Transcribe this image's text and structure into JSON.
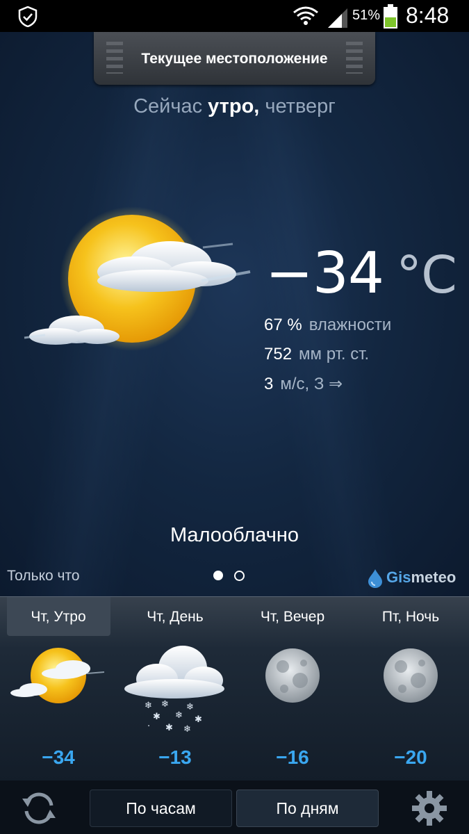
{
  "status_bar": {
    "battery_percent": "51%",
    "time": "8:48",
    "icons": [
      "shield-check-icon",
      "wifi-icon",
      "signal-icon",
      "battery-icon"
    ]
  },
  "location": {
    "title": "Текущее местоположение"
  },
  "now": {
    "prefix": "Сейчас",
    "period": "утро,",
    "weekday": "четверг"
  },
  "current": {
    "temperature": "−34",
    "unit": "°C",
    "humidity_value": "67 %",
    "humidity_label": "влажности",
    "pressure_value": "752",
    "pressure_label": "мм рт. ст.",
    "wind_value": "3",
    "wind_label": "м/с, З ⇒",
    "condition": "Малооблачно",
    "icon": "sun-partly-cloudy-icon"
  },
  "updated": "Только что",
  "pager": {
    "total": 2,
    "active": 1
  },
  "brand": {
    "name_a": "Gis",
    "name_b": "meteo"
  },
  "forecast": [
    {
      "label": "Чт, Утро",
      "temp": "−34",
      "icon": "sun-partly-cloudy-icon",
      "selected": true
    },
    {
      "label": "Чт, День",
      "temp": "−13",
      "icon": "cloud-snow-icon",
      "selected": false
    },
    {
      "label": "Чт, Вечер",
      "temp": "−16",
      "icon": "moon-icon",
      "selected": false
    },
    {
      "label": "Пт, Ночь",
      "temp": "−20",
      "icon": "moon-icon",
      "selected": false
    }
  ],
  "bottom": {
    "hours_label": "По часам",
    "days_label": "По дням",
    "active": "days"
  },
  "colors": {
    "accent_temp": "#3aa7f0",
    "background": "#132741"
  }
}
